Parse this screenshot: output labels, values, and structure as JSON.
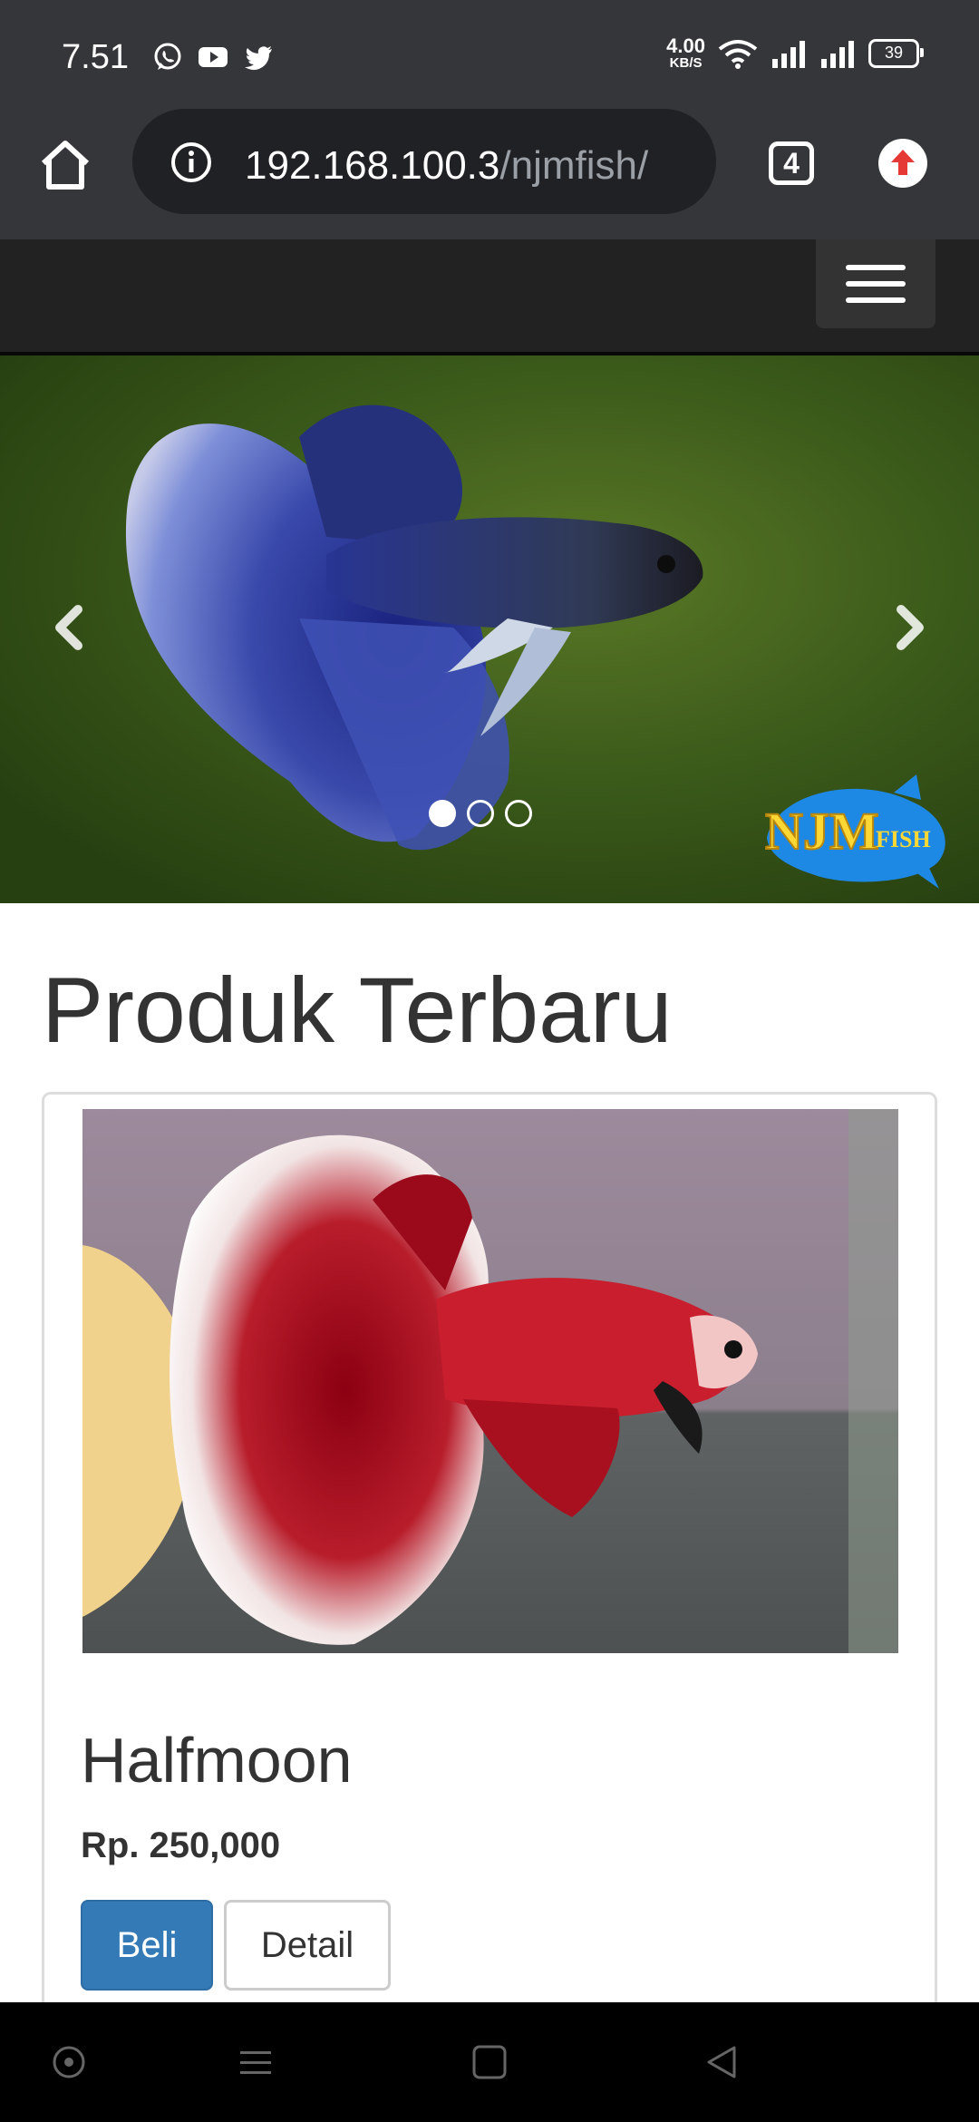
{
  "status_bar": {
    "time": "7.51",
    "apps": [
      "whatsapp-icon",
      "youtube-icon",
      "twitter-icon"
    ],
    "net_speed_value": "4.00",
    "net_speed_unit": "KB/S",
    "battery": "39"
  },
  "browser": {
    "url_host": "192.168.100.3",
    "url_path": "/njmfish/",
    "tab_count": "4"
  },
  "carousel": {
    "slide_count": 3,
    "active_slide": 1,
    "logo_text": "NJM",
    "logo_subtext": "FISH"
  },
  "main": {
    "heading": "Produk Terbaru"
  },
  "product": {
    "name": "Halfmoon",
    "price": "Rp. 250,000",
    "buy_label": "Beli",
    "detail_label": "Detail"
  },
  "colors": {
    "chrome_bg": "#35363a",
    "navbar_bg": "#222222",
    "primary": "#337ab7"
  }
}
